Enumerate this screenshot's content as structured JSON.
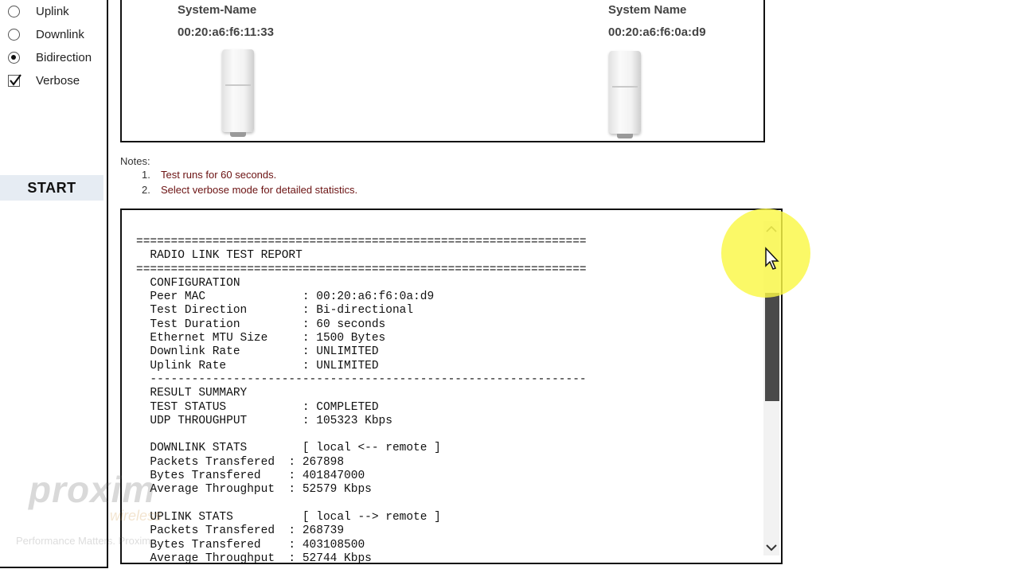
{
  "controls": {
    "options": [
      {
        "label": "Uplink",
        "type": "radio",
        "checked": false
      },
      {
        "label": "Downlink",
        "type": "radio",
        "checked": false
      },
      {
        "label": "Bidirection",
        "type": "radio",
        "checked": true
      },
      {
        "label": "Verbose",
        "type": "checkbox",
        "checked": true
      }
    ],
    "start_label": "START"
  },
  "devices": {
    "local": {
      "name": "System-Name",
      "mac": "00:20:a6:f6:11:33"
    },
    "remote": {
      "name": "System Name",
      "mac": "00:20:a6:f6:0a:d9"
    }
  },
  "notes": {
    "title": "Notes:",
    "items": [
      {
        "num": "1.",
        "text": "Test runs for 60 seconds."
      },
      {
        "num": "2.",
        "text": "Select verbose mode for detailed statistics."
      }
    ]
  },
  "report": {
    "text": "=================================================================\n  RADIO LINK TEST REPORT\n=================================================================\n  CONFIGURATION\n  Peer MAC              : 00:20:a6:f6:0a:d9\n  Test Direction        : Bi-directional\n  Test Duration         : 60 seconds\n  Ethernet MTU Size     : 1500 Bytes\n  Downlink Rate         : UNLIMITED\n  Uplink Rate           : UNLIMITED\n  ---------------------------------------------------------------\n  RESULT SUMMARY\n  TEST STATUS           : COMPLETED\n  UDP THROUGHPUT        : 105323 Kbps\n\n  DOWNLINK STATS        [ local <-- remote ]\n  Packets Transfered  : 267898\n  Bytes Transfered    : 401847000\n  Average Throughput  : 52579 Kbps\n\n  UPLINK STATS          [ local --> remote ]\n  Packets Transfered  : 268739\n  Bytes Transfered    : 403108500\n  Average Throughput  : 52744 Kbps"
  },
  "watermark": {
    "logo": "proxim",
    "sub": "wireless",
    "tagline": "Performance Matters. Proxim."
  },
  "colors": {
    "start_bg": "#e6ecf3",
    "notes_item": "#6b1212",
    "cursor_halo": "#faf846",
    "scroll_thumb": "#4a4a4a"
  }
}
